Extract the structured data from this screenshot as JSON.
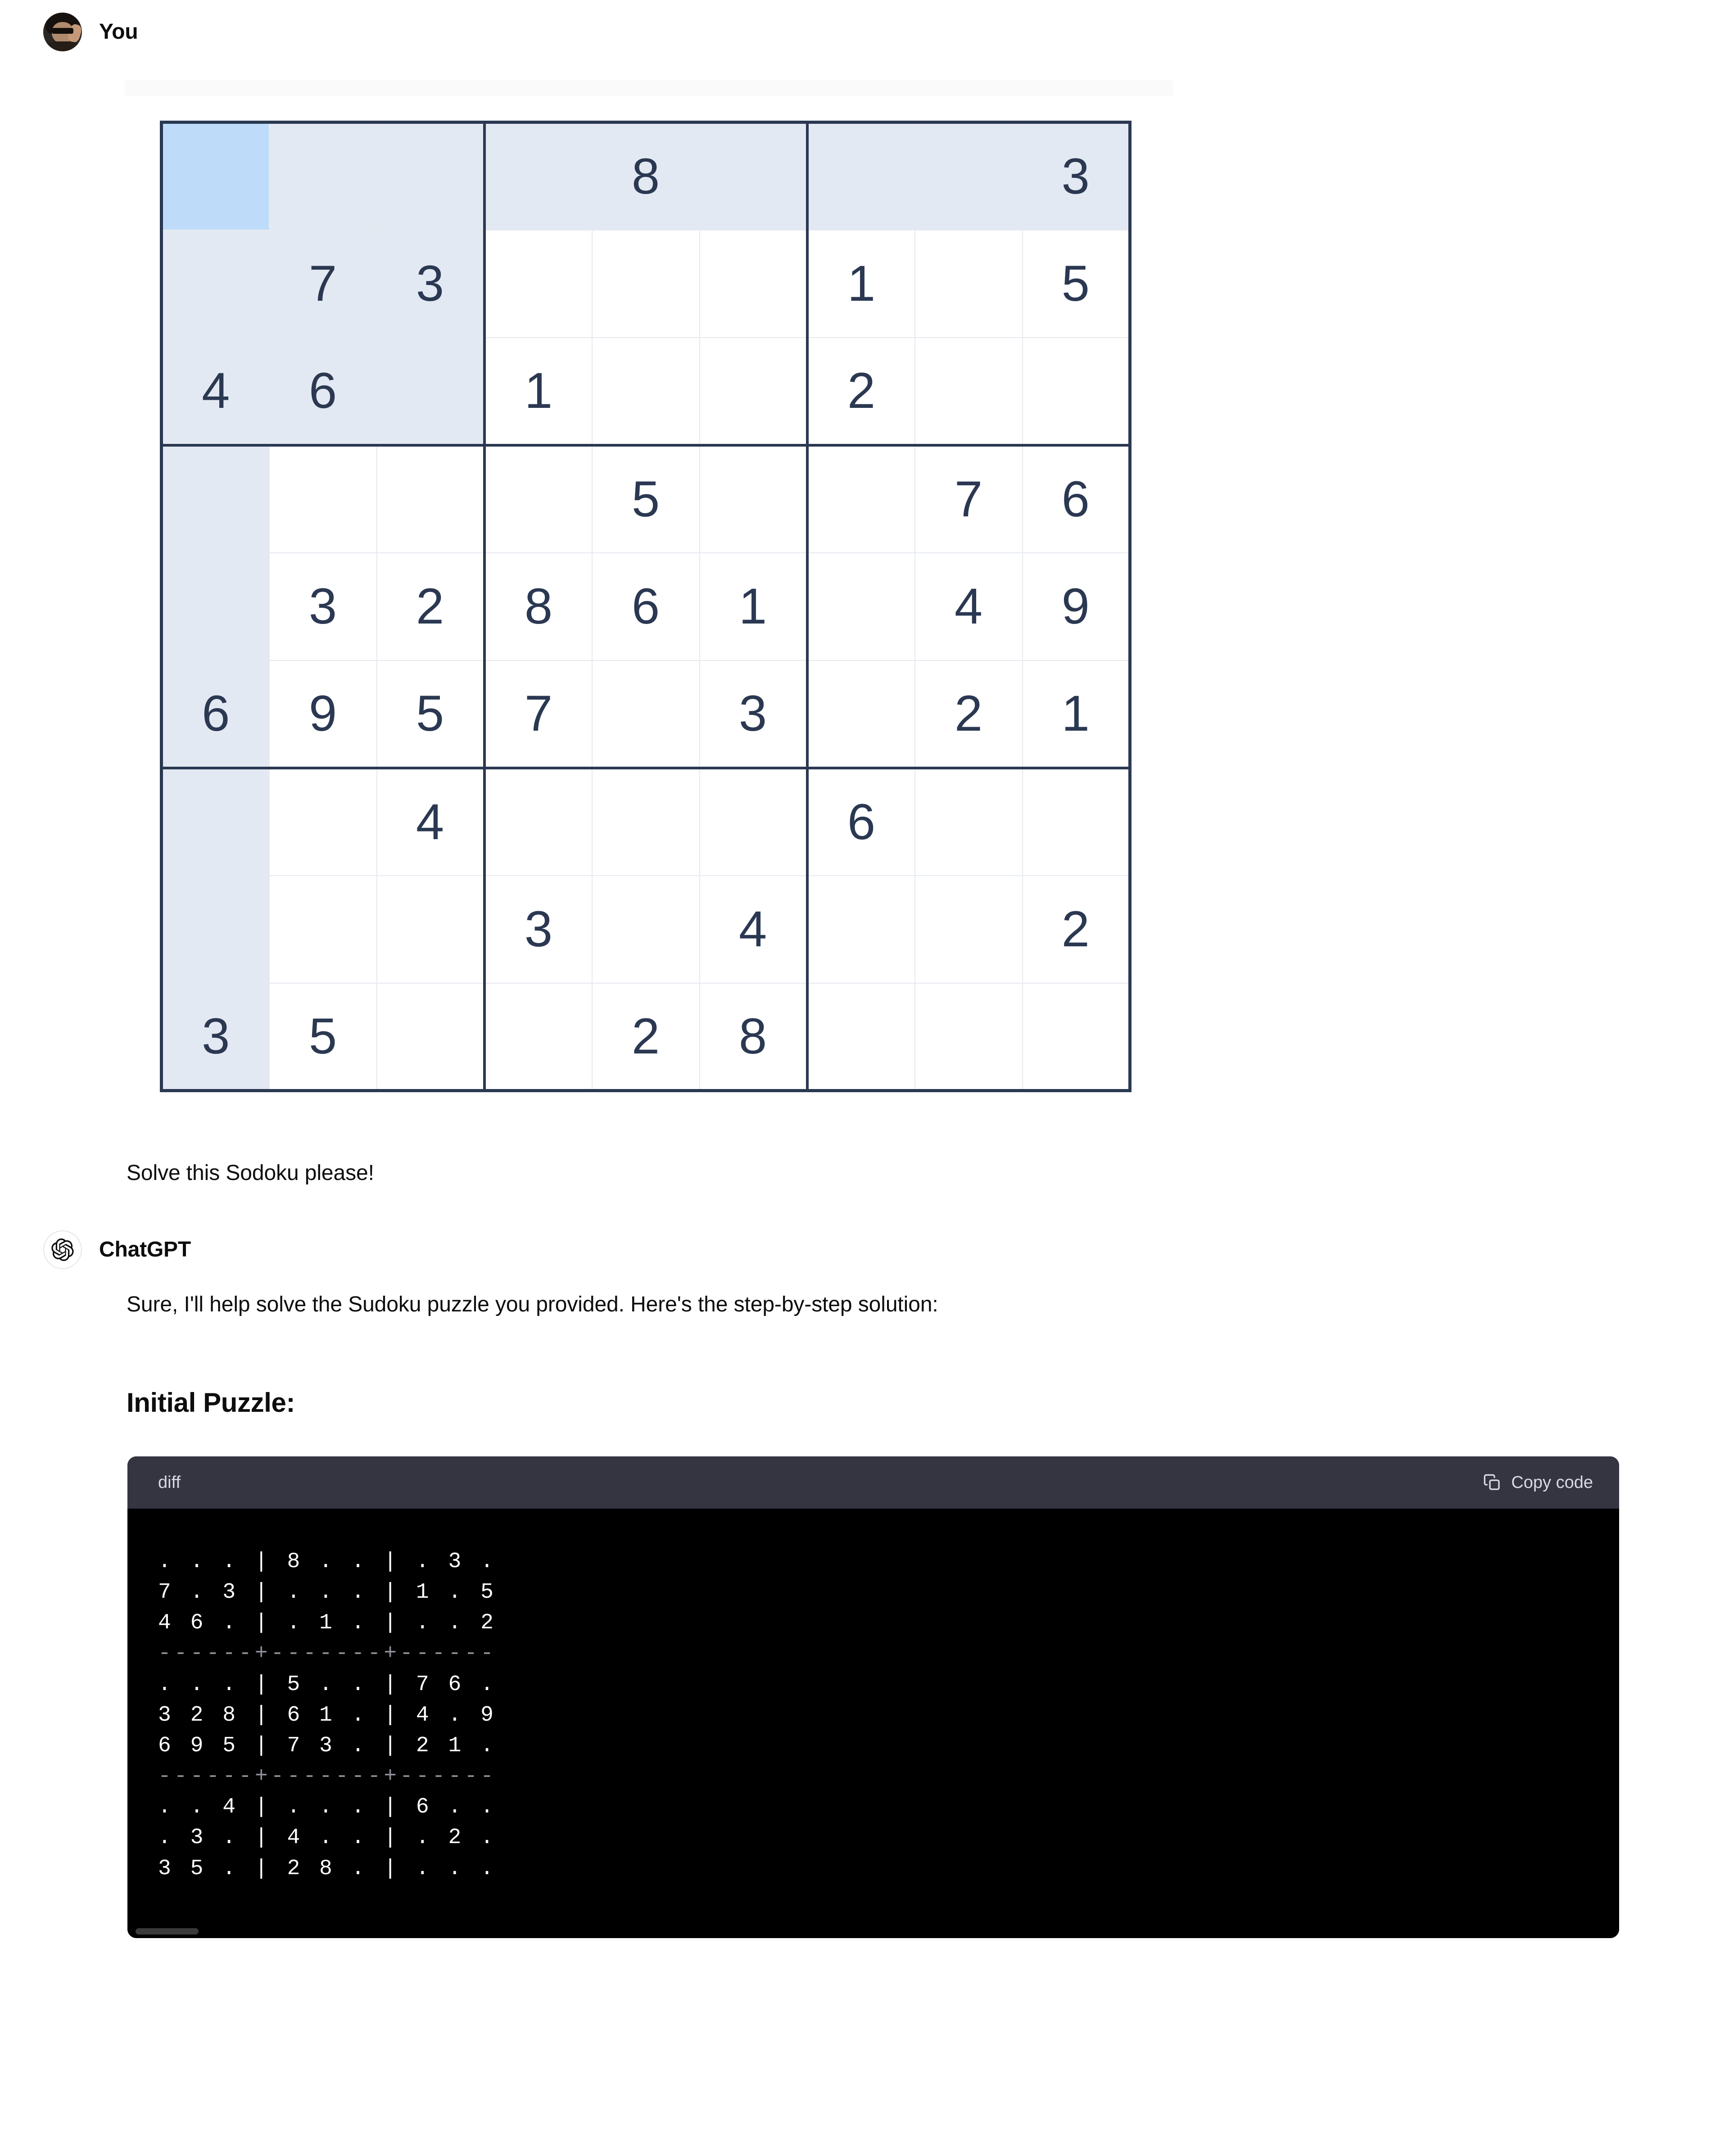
{
  "conversation": {
    "user": {
      "author": "You",
      "avatar_icon": "user-photo-avatar",
      "prompt_text": "Solve this Sodoku please!"
    },
    "assistant": {
      "author": "ChatGPT",
      "avatar_icon": "openai-logo-icon",
      "intro_text": "Sure, I'll help solve the Sudoku puzzle you provided. Here's the step-by-step solution:",
      "section_heading": "Initial Puzzle:"
    }
  },
  "code_block": {
    "language_label": "diff",
    "copy_label": "Copy code",
    "copy_icon": "copy-icon",
    "lines": [
      ". . . | 8 . . | . 3 .",
      "7 . 3 | . . . | 1 . 5",
      "4 6 . | . 1 . | . . 2",
      "------+-------+------",
      ". . . | 5 . . | 7 6 .",
      "3 2 8 | 6 1 . | 4 . 9",
      "6 9 5 | 7 3 . | 2 1 .",
      "------+-------+------",
      ". . 4 | . . . | 6 . .",
      ". 3 . | 4 . . | . 2 .",
      "3 5 . | 2 8 . | . . ."
    ]
  },
  "sudoku": {
    "selected_cell": {
      "row": 0,
      "col": 0
    },
    "colors": {
      "selected_cell": "#bedcfa",
      "highlight": "#e3e9f2",
      "digit": "#2b3852",
      "border_bold": "#2b3852",
      "border_light": "#e5e9ef"
    },
    "grid": [
      [
        "",
        "",
        "",
        "",
        "8",
        "",
        "",
        "",
        "3"
      ],
      [
        "",
        "7",
        "3",
        "",
        "",
        "",
        "1",
        "",
        "5"
      ],
      [
        "4",
        "6",
        "",
        "1",
        "",
        "",
        "2",
        "",
        ""
      ],
      [
        "",
        "",
        "",
        "",
        "5",
        "",
        "",
        "7",
        "6"
      ],
      [
        "",
        "3",
        "2",
        "8",
        "6",
        "1",
        "",
        "4",
        "9"
      ],
      [
        "6",
        "9",
        "5",
        "7",
        "",
        "3",
        "",
        "2",
        "1"
      ],
      [
        "",
        "",
        "4",
        "",
        "",
        "",
        "6",
        "",
        ""
      ],
      [
        "",
        "",
        "",
        "3",
        "",
        "4",
        "",
        "",
        "2"
      ],
      [
        "3",
        "5",
        "",
        "",
        "2",
        "8",
        "",
        "",
        ""
      ]
    ]
  }
}
